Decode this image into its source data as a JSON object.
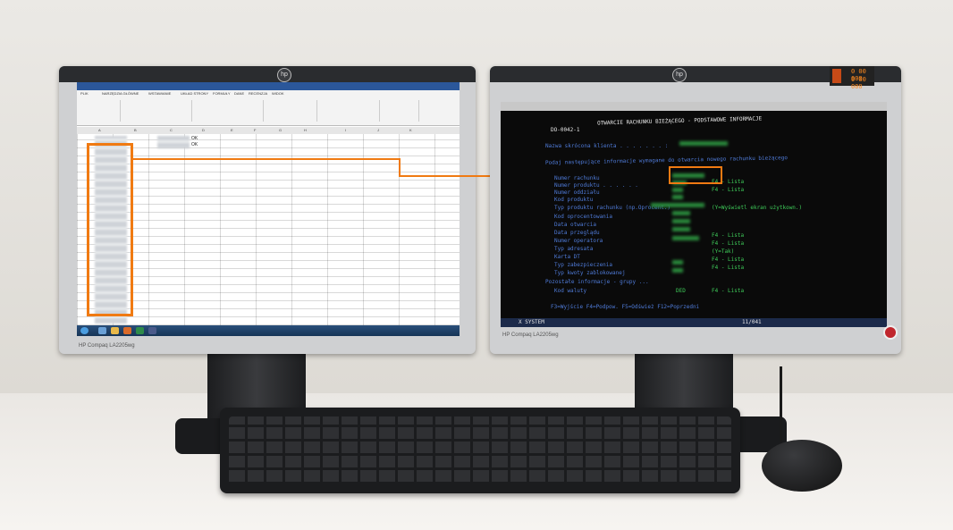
{
  "left_monitor": {
    "brand": "HP Compaq LA2205wg",
    "excel": {
      "ribbon_tabs": [
        "PLIK",
        "NARZĘDZIA GŁÓWNE",
        "WSTAWIANIE",
        "UKŁAD STRONY",
        "FORMUŁY",
        "DANE",
        "RECENZJA",
        "WIDOK"
      ],
      "column_headers": [
        "A",
        "B",
        "C",
        "D",
        "E",
        "F",
        "G",
        "H",
        "I",
        "J",
        "K"
      ],
      "ok_cells": [
        "OK",
        "OK"
      ]
    }
  },
  "right_monitor": {
    "terminal": {
      "screen_id": "DO-0042-1",
      "title": "OTWARCIE RACHUNKU BIEŻĄCEGO - PODSTAWOWE INFORMACJE",
      "short_name_label": "Nazwa skrócona klienta . . . . . . . :",
      "instruction": "Podaj następujące informacje wymagane do otwarcia nowego rachunku bieżącego",
      "fields": [
        "Numer rachunku",
        "Numer produktu . . . . . .",
        "Numer oddziału",
        "Kod produktu",
        "Typ produktu rachunku (np.Oprocent.)",
        "Kod oprocentowania",
        "Data otwarcia",
        "Data przeglądu",
        "Numer operatora",
        "Typ adresata",
        "Karta DT",
        "Typ zabezpieczenia",
        "Typ kwoty zablokowanej",
        "Pozostałe informacje - grupy ...",
        "Kod waluty"
      ],
      "hints": [
        "F4 - Lista",
        "F4 - Lista",
        "(Y=Wyświetl ekran użytkown.)",
        "F4 - Lista",
        "F4 - Lista",
        "(Y=Tak)",
        "F4 - Lista",
        "F4 - Lista",
        "F4 - Lista"
      ],
      "currency_value": "DED",
      "function_keys": "F3=Wyjście   F4=Podpow.   F5=Odśwież   F12=Poprzedni",
      "status_bar_app": "X SYSTEM",
      "page_indicator": "11/041"
    },
    "counter": {
      "value_top": "0 00 000",
      "value_bottom": "0 00 000"
    }
  }
}
